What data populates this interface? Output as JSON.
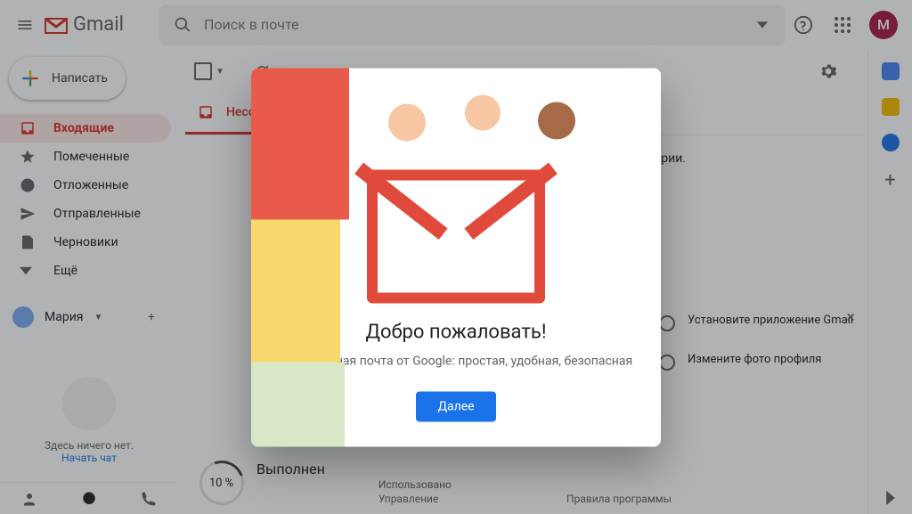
{
  "header": {
    "app_name": "Gmail",
    "search_placeholder": "Поиск в почте",
    "avatar_initial": "М"
  },
  "sidebar": {
    "compose_label": "Написать",
    "items": [
      {
        "label": "Входящие",
        "icon": "inbox"
      },
      {
        "label": "Помеченные",
        "icon": "star"
      },
      {
        "label": "Отложенные",
        "icon": "clock"
      },
      {
        "label": "Отправленные",
        "icon": "sent"
      },
      {
        "label": "Черновики",
        "icon": "draft"
      },
      {
        "label": "Ещё",
        "icon": "more"
      }
    ],
    "user_name": "Мария",
    "empty_title": "Здесь ничего нет.",
    "empty_action": "Начать чат"
  },
  "tabs": [
    {
      "label": "Несортированные"
    }
  ],
  "main": {
    "category_hint": "егории."
  },
  "tips": {
    "tip1": "Установите приложение Gmail",
    "tip2": "Измените фото профиля"
  },
  "storage": {
    "percent_label": "10 %",
    "done_label": "Выполнен",
    "used_line": "Использовано",
    "manage_label": "Управление"
  },
  "footer": {
    "rules_label": "Правила программы"
  },
  "dialog": {
    "title": "Добро пожаловать!",
    "subtitle": "Электронная почта от Google: простая, удобная, безопасная",
    "next_label": "Далее"
  }
}
